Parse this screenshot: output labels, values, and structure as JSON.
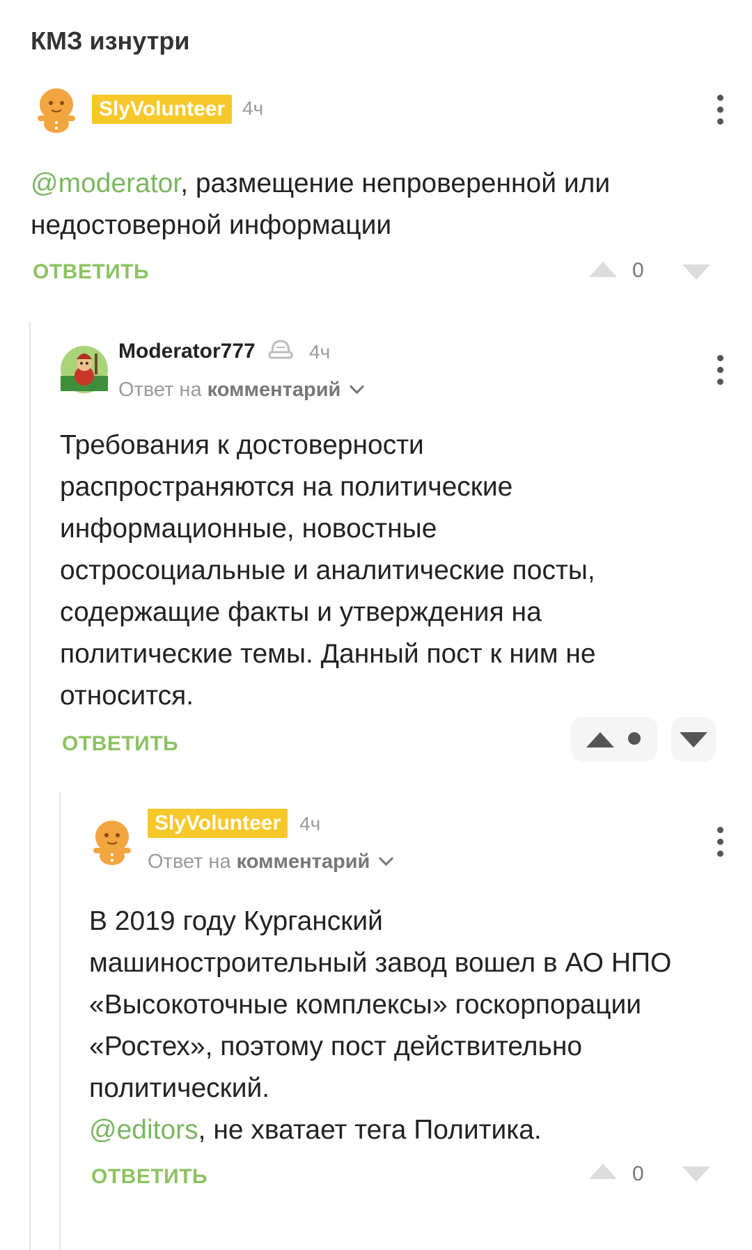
{
  "post": {
    "title": "КМЗ изнутри"
  },
  "comments": [
    {
      "username": "SlyVolunteer",
      "time": "4ч",
      "mention": "@moderator",
      "text": ", размещение непроверенной или недостоверной информации",
      "reply_label": "ОТВЕТИТЬ",
      "votes": "0",
      "avatar_icon": "gingerbread-avatar",
      "menu_icon": "kebab-menu-icon"
    },
    {
      "username": "Moderator777",
      "time": "4ч",
      "reply_prefix": "Ответ на",
      "reply_target": "комментарий",
      "text_lines": [
        "Требования к достоверности",
        "распространяются на политические",
        "информационные, новостные",
        "остросоциальные и аналитические посты,",
        "содержащие факты и утверждения на",
        "политические темы. Данный пост к ним не",
        "относится."
      ],
      "reply_label": "ОТВЕТИТЬ",
      "votes": "•",
      "avatar_icon": "moderator-avatar",
      "badge_icon": "moderator-hat-icon"
    },
    {
      "username": "SlyVolunteer",
      "time": "4ч",
      "reply_prefix": "Ответ на",
      "reply_target": "комментарий",
      "text_lines": [
        "В 2019 году Курганский",
        "машиностроительный завод вошел в АО НПО",
        "«Высокоточные комплексы» госкорпорации",
        "«Ростех», поэтому пост действительно",
        "политический."
      ],
      "mention": "@editors",
      "mention_tail": ", не хватает тега Политика.",
      "reply_label": "ОТВЕТИТЬ",
      "votes": "0"
    }
  ],
  "colors": {
    "username_badge": "#f7c829",
    "mention": "#7bb661",
    "reply_button": "#8dc263"
  }
}
